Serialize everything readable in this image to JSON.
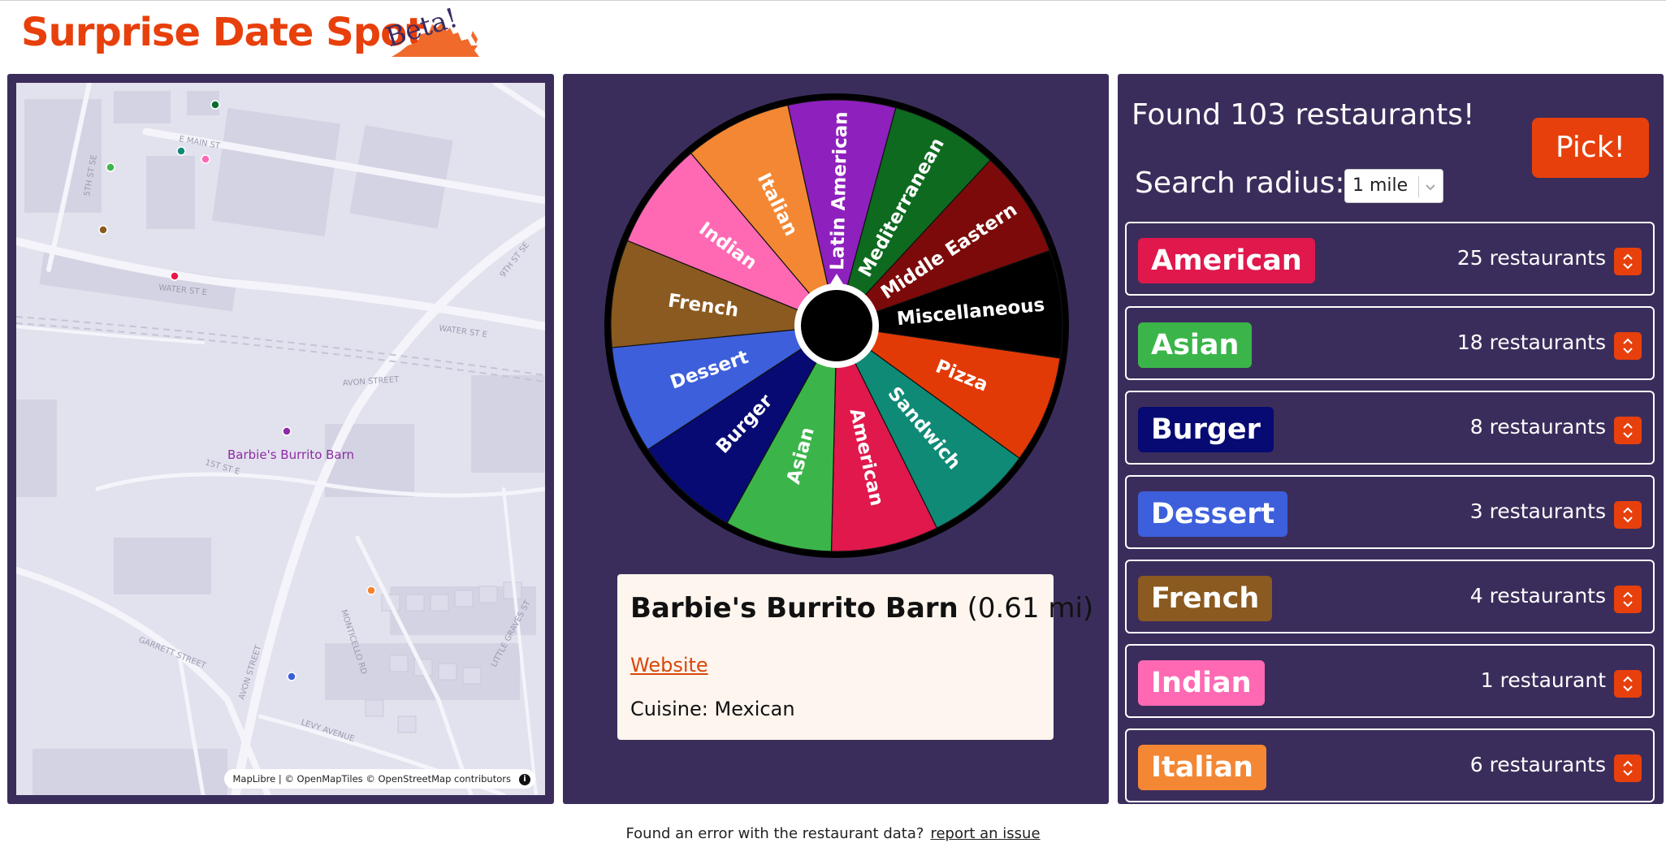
{
  "header": {
    "title": "Surprise Date Spot",
    "badge": "Beta!",
    "accent": "#e8400c",
    "panel_color": "#3b2d5b"
  },
  "map": {
    "selected_label": "Barbie's Burrito Barn",
    "streets": [
      "E MAIN ST",
      "WATER ST E",
      "WATER ST E",
      "AVON STREET",
      "1ST ST E",
      "GARRETT STREET",
      "AVON STREET",
      "MONTICELLO RD",
      "LEVY AVENUE",
      "LITTLE GRAVES ST",
      "9TH ST SE",
      "5TH ST SE"
    ],
    "attribution": "MapLibre | © OpenMapTiles © OpenStreetMap contributors",
    "info_icon": "i",
    "markers": [
      {
        "color": "#0b6b2a"
      },
      {
        "color": "#12887a"
      },
      {
        "color": "#ff69b4"
      },
      {
        "color": "#3cb54a"
      },
      {
        "color": "#8b5a1e"
      },
      {
        "color": "#e8174a"
      },
      {
        "color": "#8e2aa8"
      },
      {
        "color": "#f4832d"
      },
      {
        "color": "#3a5fd8"
      }
    ]
  },
  "wheel": {
    "segments": [
      {
        "label": "Latin American",
        "color": "#8e20bd"
      },
      {
        "label": "Mediterranean",
        "color": "#0e6a1f"
      },
      {
        "label": "Middle Eastern",
        "color": "#7d0a0a"
      },
      {
        "label": "Miscellaneous",
        "color": "#000000"
      },
      {
        "label": "Pizza",
        "color": "#e23a06"
      },
      {
        "label": "Sandwich",
        "color": "#0f8a76"
      },
      {
        "label": "American",
        "color": "#e0184c"
      },
      {
        "label": "Asian",
        "color": "#3bb54a"
      },
      {
        "label": "Burger",
        "color": "#060a72"
      },
      {
        "label": "Dessert",
        "color": "#3d5fdb"
      },
      {
        "label": "French",
        "color": "#8b5a20"
      },
      {
        "label": "Indian",
        "color": "#ff69b4"
      },
      {
        "label": "Italian",
        "color": "#f48733"
      }
    ]
  },
  "result": {
    "name": "Barbie's Burrito Barn",
    "distance": "(0.61 mi)",
    "website_label": "Website",
    "cuisine": "Cuisine: Mexican"
  },
  "list": {
    "found_text": "Found 103 restaurants!",
    "pick_label": "Pick!",
    "radius_label": "Search radius:",
    "radius_value": "1 mile",
    "categories": [
      {
        "name": "American",
        "count": "25 restaurants",
        "color": "#e0184c"
      },
      {
        "name": "Asian",
        "count": "18 restaurants",
        "color": "#3bb54a"
      },
      {
        "name": "Burger",
        "count": "8 restaurants",
        "color": "#060a72"
      },
      {
        "name": "Dessert",
        "count": "3 restaurants",
        "color": "#3d5fdb"
      },
      {
        "name": "French",
        "count": "4 restaurants",
        "color": "#8b5a20"
      },
      {
        "name": "Indian",
        "count": "1 restaurant",
        "color": "#ff69b4"
      },
      {
        "name": "Italian",
        "count": "6 restaurants",
        "color": "#f48733"
      }
    ]
  },
  "footer": {
    "text": "Found an error with the restaurant data?",
    "link": "report an issue"
  }
}
